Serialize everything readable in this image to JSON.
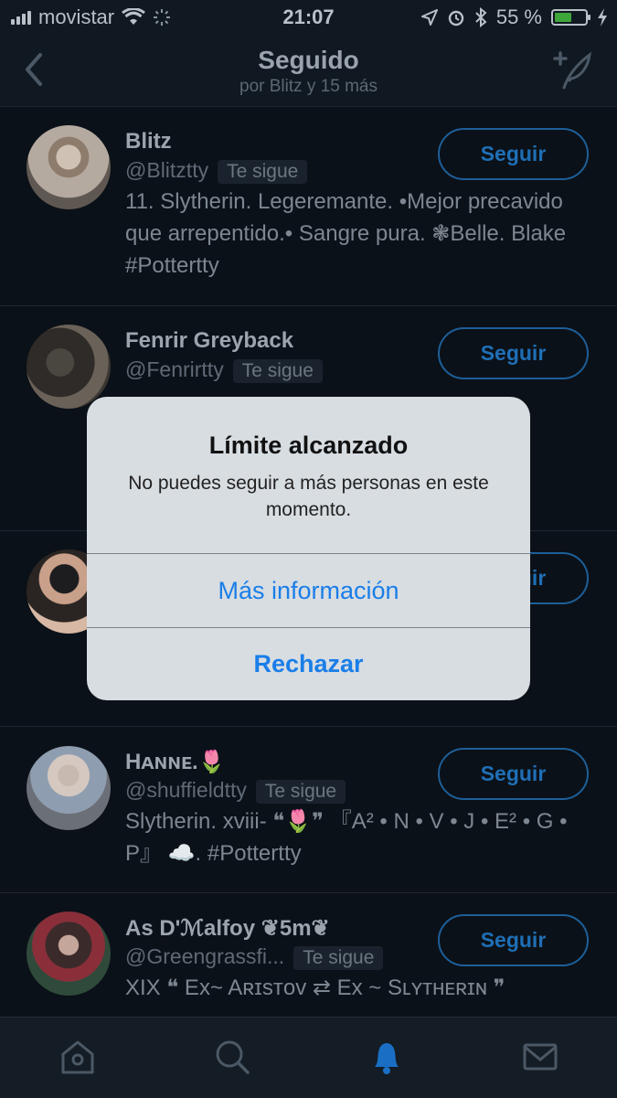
{
  "status": {
    "carrier": "movistar",
    "time": "21:07",
    "battery_text": "55 %",
    "battery_level": 0.55
  },
  "header": {
    "title": "Seguido",
    "subtitle": "por Blitz y 15 más"
  },
  "users": [
    {
      "name": "Blitz",
      "handle": "@Blitztty",
      "badge": "Te sigue",
      "bio": "11. Slytherin. Legeremante. •Mejor precavido que arrepentido.• Sangre pura. ❃Belle. Blake #Pottertty",
      "button": "Seguir"
    },
    {
      "name": "Fenrir Greyback",
      "handle": "@Fenrirtty",
      "badge": "Te sigue",
      "bio": "",
      "button": "Seguir"
    },
    {
      "name": "",
      "handle": "",
      "badge": "",
      "bio": "",
      "button": "Seguir"
    },
    {
      "name": "Hᴀɴɴᴇ.🌷",
      "handle": "@shuffieldtty",
      "badge": "Te sigue",
      "bio": "Slytherin. xviii- ❝🌷❞ 『A² • N • V • J • E² • G • P』 ☁️. #Pottertty",
      "button": "Seguir"
    },
    {
      "name": "As D'ℳalfoy ❦5m❦",
      "handle": "@Greengrassfi...",
      "badge": "Te sigue",
      "bio": "XIX ❝ Ex~ Aʀɪsᴛᴏᴠ ⇄ Ex ~ Sʟʏᴛʜᴇʀɪɴ ❞",
      "button": "Seguir"
    }
  ],
  "alert": {
    "title": "Límite alcanzado",
    "message": "No puedes seguir a más personas en este momento.",
    "primary_button": "Más información",
    "secondary_button": "Rechazar"
  },
  "colors": {
    "accent": "#1a7ee8",
    "follow_border": "#1d5f99",
    "background": "#0a1016"
  },
  "tabs": [
    {
      "name": "home",
      "icon": "home-icon"
    },
    {
      "name": "search",
      "icon": "search-icon"
    },
    {
      "name": "notifications",
      "icon": "bell-icon",
      "active": true
    },
    {
      "name": "messages",
      "icon": "mail-icon"
    }
  ]
}
